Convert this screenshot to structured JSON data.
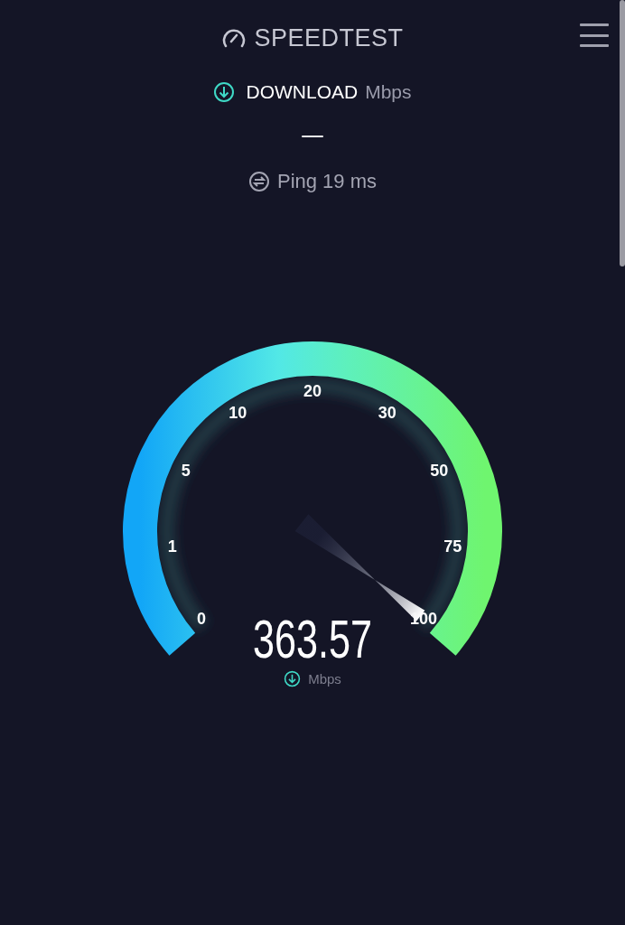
{
  "header": {
    "logo": "SPEEDTEST"
  },
  "test": {
    "label": "DOWNLOAD",
    "unit": "Mbps",
    "value": "—"
  },
  "ping": {
    "label": "Ping 19 ms"
  },
  "gauge": {
    "ticks": [
      "0",
      "1",
      "5",
      "10",
      "20",
      "30",
      "50",
      "75",
      "100"
    ],
    "reading": "363.57",
    "unit": "Mbps"
  }
}
